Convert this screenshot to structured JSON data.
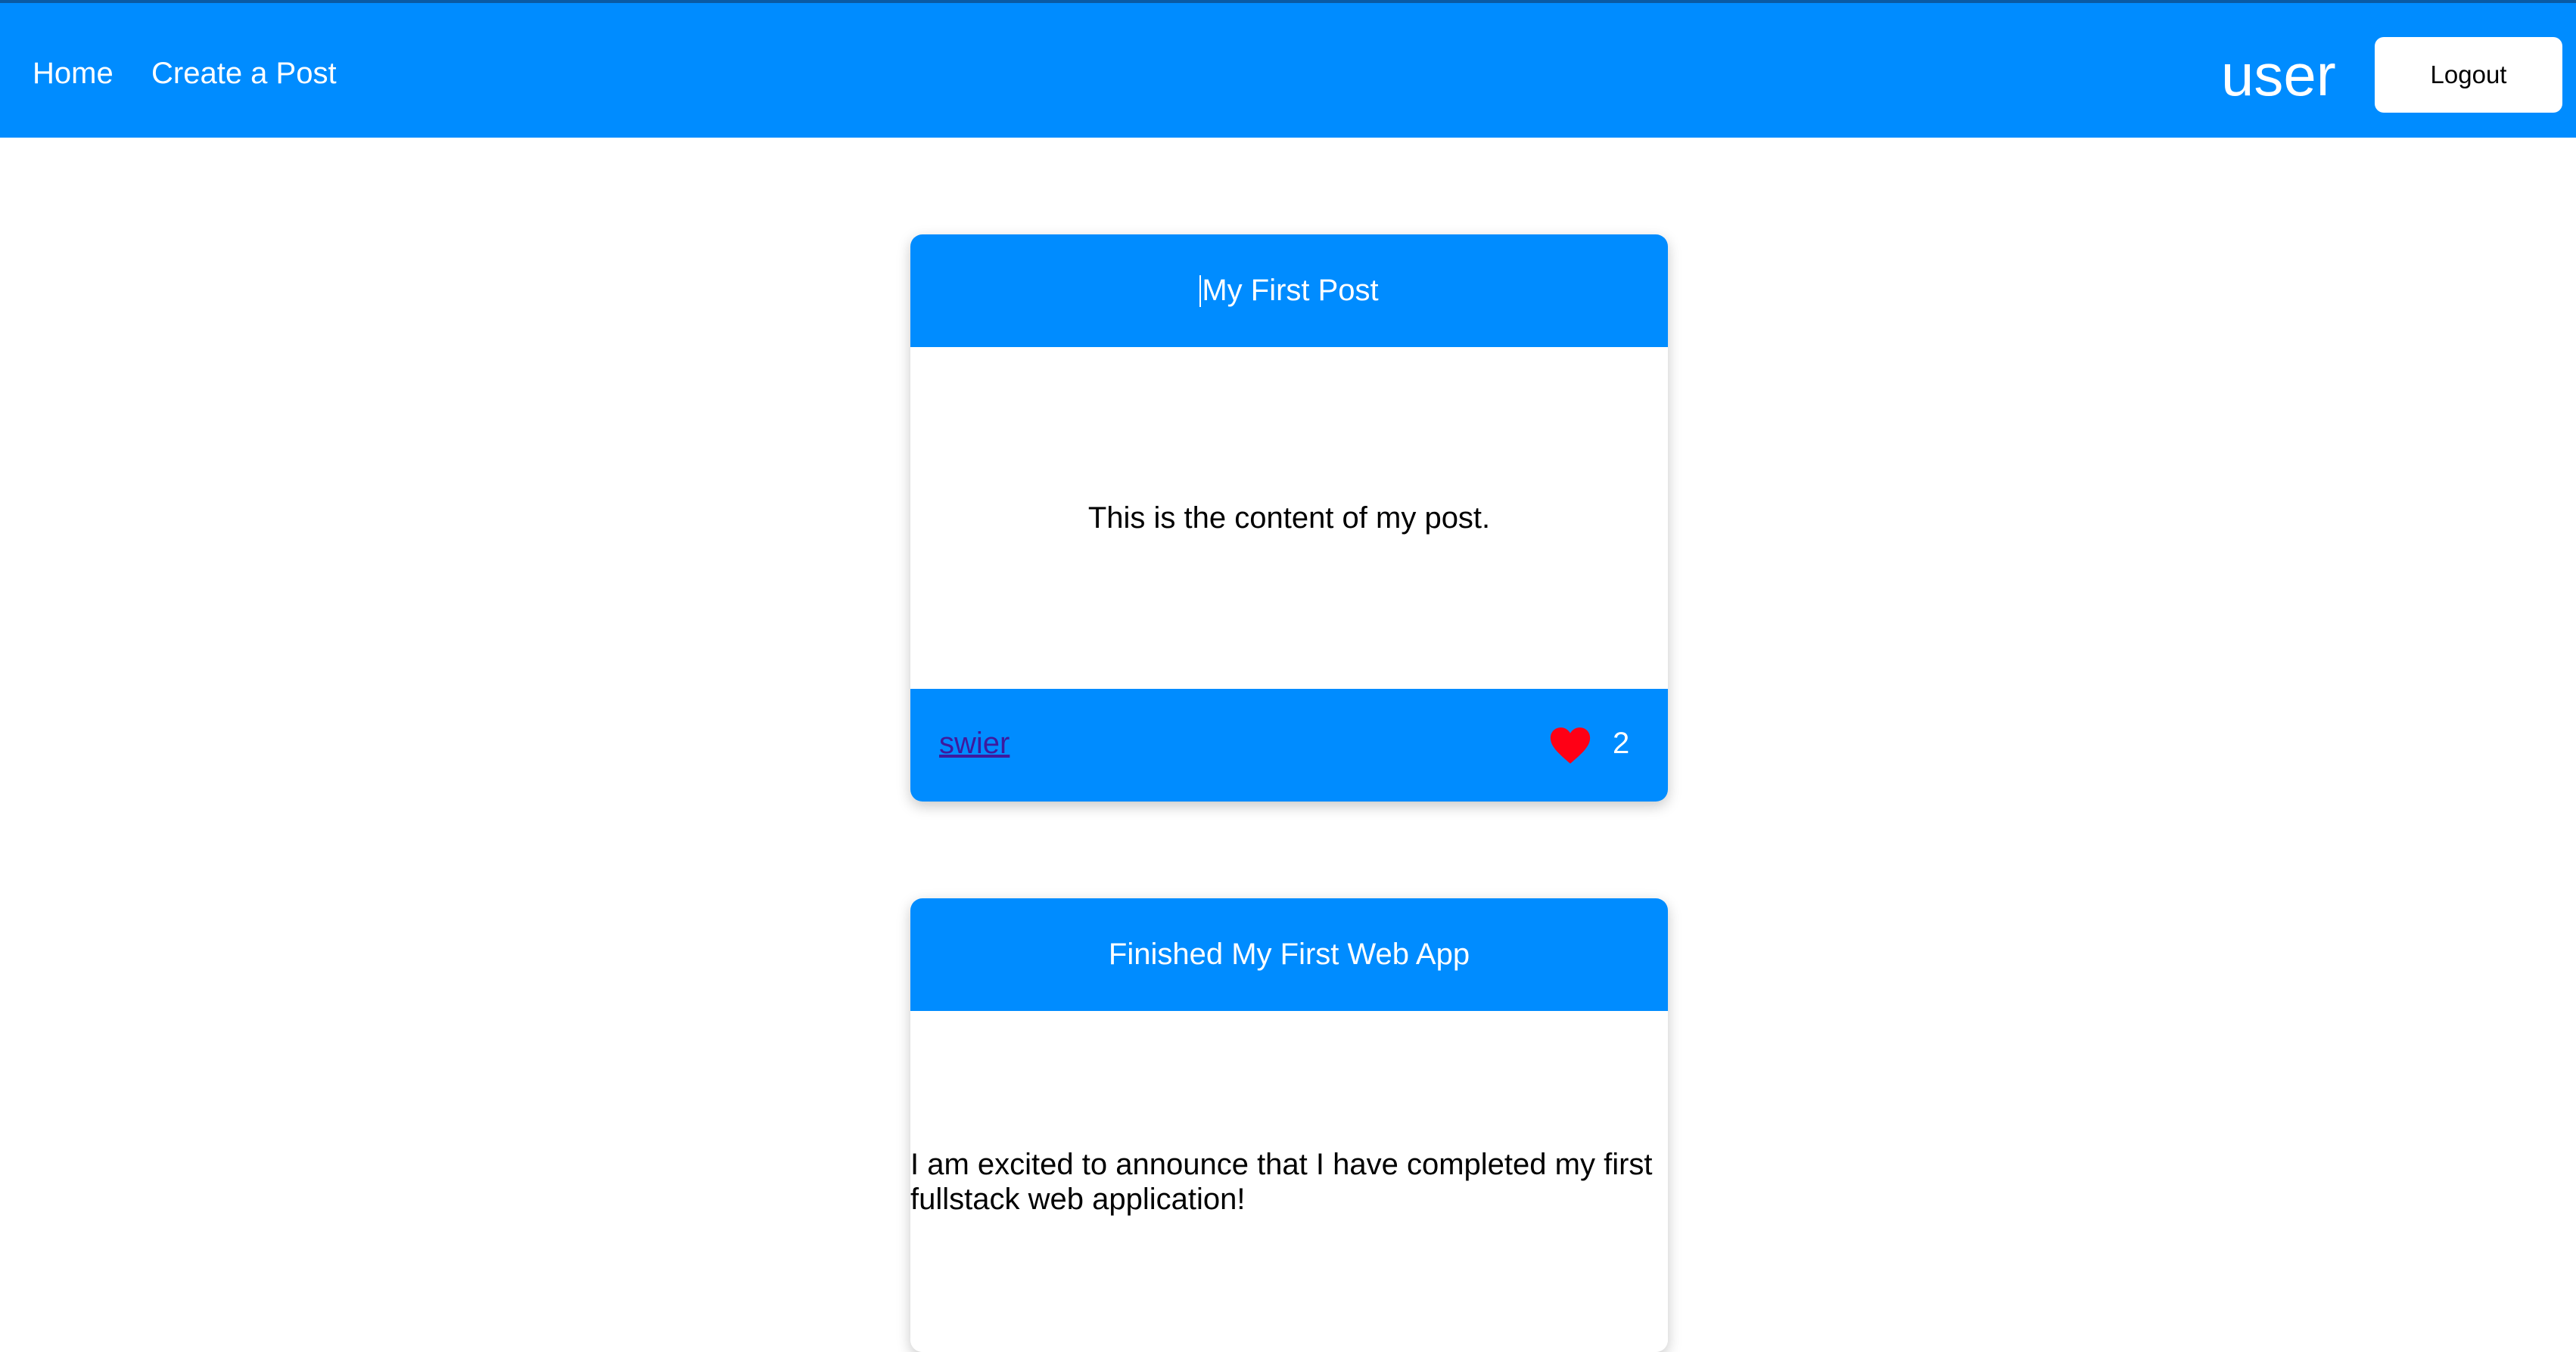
{
  "nav": {
    "home_label": "Home",
    "create_label": "Create a Post",
    "username": "user",
    "logout_label": "Logout"
  },
  "colors": {
    "primary": "#008cff",
    "heart": "#ff0015",
    "author_link": "#3e1a9e"
  },
  "posts": [
    {
      "title": "My First Post",
      "content": "This is the content of my post.",
      "author": "swier",
      "likes": "2"
    },
    {
      "title": "Finished My First Web App",
      "content": "I am excited to announce that I have completed my first fullstack web application!"
    }
  ]
}
